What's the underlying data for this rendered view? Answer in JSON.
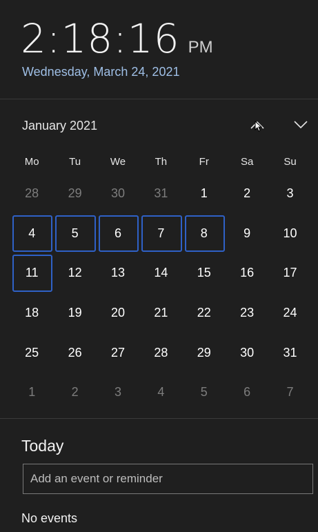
{
  "clock": {
    "time": "2:18:16",
    "ampm": "PM",
    "date": "Wednesday, March 24, 2021"
  },
  "calendar": {
    "month_label": "January 2021",
    "prev_icon": "chevron-up-icon",
    "next_icon": "chevron-down-icon",
    "weekdays": [
      "Mo",
      "Tu",
      "We",
      "Th",
      "Fr",
      "Sa",
      "Su"
    ],
    "days": [
      {
        "label": "28",
        "muted": true,
        "highlighted": false
      },
      {
        "label": "29",
        "muted": true,
        "highlighted": false
      },
      {
        "label": "30",
        "muted": true,
        "highlighted": false
      },
      {
        "label": "31",
        "muted": true,
        "highlighted": false
      },
      {
        "label": "1",
        "muted": false,
        "highlighted": false
      },
      {
        "label": "2",
        "muted": false,
        "highlighted": false
      },
      {
        "label": "3",
        "muted": false,
        "highlighted": false
      },
      {
        "label": "4",
        "muted": false,
        "highlighted": true
      },
      {
        "label": "5",
        "muted": false,
        "highlighted": true
      },
      {
        "label": "6",
        "muted": false,
        "highlighted": true
      },
      {
        "label": "7",
        "muted": false,
        "highlighted": true
      },
      {
        "label": "8",
        "muted": false,
        "highlighted": true
      },
      {
        "label": "9",
        "muted": false,
        "highlighted": false
      },
      {
        "label": "10",
        "muted": false,
        "highlighted": false
      },
      {
        "label": "11",
        "muted": false,
        "highlighted": true
      },
      {
        "label": "12",
        "muted": false,
        "highlighted": false
      },
      {
        "label": "13",
        "muted": false,
        "highlighted": false
      },
      {
        "label": "14",
        "muted": false,
        "highlighted": false
      },
      {
        "label": "15",
        "muted": false,
        "highlighted": false
      },
      {
        "label": "16",
        "muted": false,
        "highlighted": false
      },
      {
        "label": "17",
        "muted": false,
        "highlighted": false
      },
      {
        "label": "18",
        "muted": false,
        "highlighted": false
      },
      {
        "label": "19",
        "muted": false,
        "highlighted": false
      },
      {
        "label": "20",
        "muted": false,
        "highlighted": false
      },
      {
        "label": "21",
        "muted": false,
        "highlighted": false
      },
      {
        "label": "22",
        "muted": false,
        "highlighted": false
      },
      {
        "label": "23",
        "muted": false,
        "highlighted": false
      },
      {
        "label": "24",
        "muted": false,
        "highlighted": false
      },
      {
        "label": "25",
        "muted": false,
        "highlighted": false
      },
      {
        "label": "26",
        "muted": false,
        "highlighted": false
      },
      {
        "label": "27",
        "muted": false,
        "highlighted": false
      },
      {
        "label": "28",
        "muted": false,
        "highlighted": false
      },
      {
        "label": "29",
        "muted": false,
        "highlighted": false
      },
      {
        "label": "30",
        "muted": false,
        "highlighted": false
      },
      {
        "label": "31",
        "muted": false,
        "highlighted": false
      },
      {
        "label": "1",
        "muted": true,
        "highlighted": false
      },
      {
        "label": "2",
        "muted": true,
        "highlighted": false
      },
      {
        "label": "3",
        "muted": true,
        "highlighted": false
      },
      {
        "label": "4",
        "muted": true,
        "highlighted": false
      },
      {
        "label": "5",
        "muted": true,
        "highlighted": false
      },
      {
        "label": "6",
        "muted": true,
        "highlighted": false
      },
      {
        "label": "7",
        "muted": true,
        "highlighted": false
      }
    ]
  },
  "events": {
    "section_title": "Today",
    "input_placeholder": "Add an event or reminder",
    "input_value": "",
    "empty_text": "No events"
  },
  "colors": {
    "background": "#1f1f1f",
    "date_text": "#9fbfe6",
    "highlight_border": "#2f61c7",
    "muted_text": "#7d7d7d"
  }
}
